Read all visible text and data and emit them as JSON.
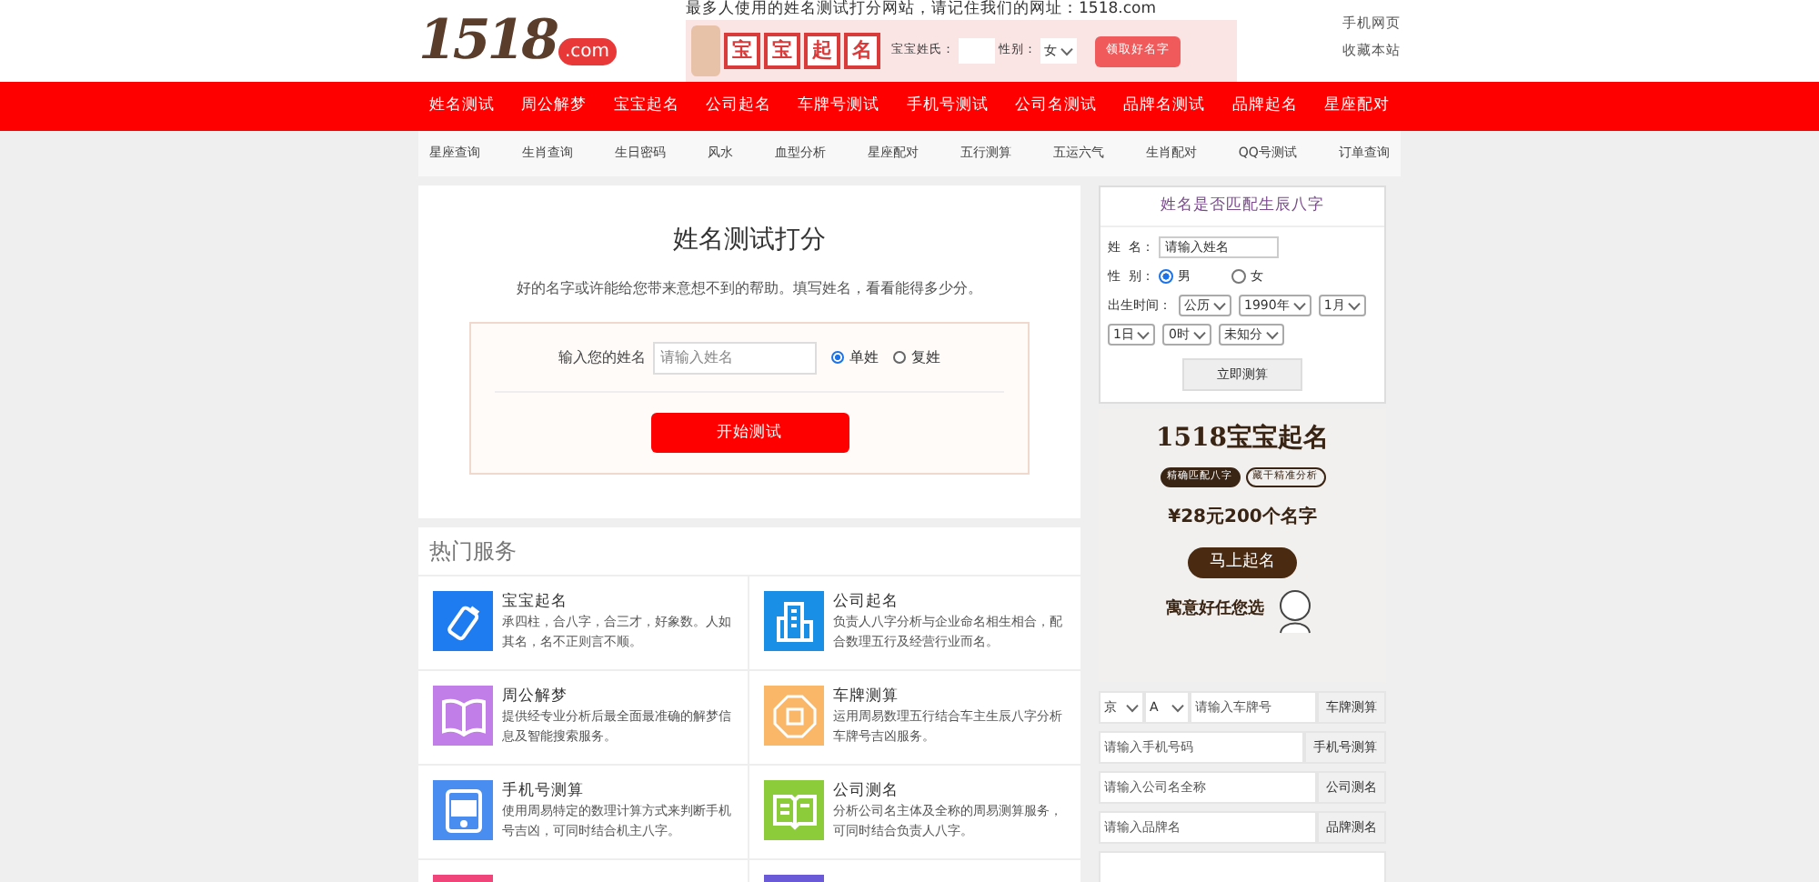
{
  "header": {
    "logo": "1518",
    "logo_badge": ".com",
    "tagline": "最多人使用的姓名测试打分网站，请记住我们的网址：1518.com",
    "promo": {
      "chars": [
        "宝",
        "宝",
        "起",
        "名"
      ],
      "surname_label": "宝宝姓氏：",
      "gender_label": "性别：",
      "gender_value": "女",
      "button": "领取好名字"
    },
    "links": [
      "手机网页",
      "收藏本站"
    ]
  },
  "nav": [
    "姓名测试",
    "周公解梦",
    "宝宝起名",
    "公司起名",
    "车牌号测试",
    "手机号测试",
    "公司名测试",
    "品牌名测试",
    "品牌起名",
    "星座配对"
  ],
  "subnav": [
    "星座查询",
    "生肖查询",
    "生日密码",
    "风水",
    "血型分析",
    "星座配对",
    "五行测算",
    "五运六气",
    "生肖配对",
    "QQ号测试",
    "订单查询"
  ],
  "test_card": {
    "title": "姓名测试打分",
    "subtitle": "好的名字或许能给您带来意想不到的帮助。填写姓名，看看能得多少分。",
    "input_label": "输入您的姓名",
    "placeholder": "请输入姓名",
    "options": [
      {
        "label": "单姓",
        "selected": true
      },
      {
        "label": "复姓",
        "selected": false
      }
    ],
    "button": "开始测试"
  },
  "services": {
    "title": "热门服务",
    "items": [
      {
        "kind": "bottle",
        "color": "#1e7cf0",
        "title": "宝宝起名",
        "desc": "承四柱，合八字，合三才，好象数。人如其名，名不正则言不顺。"
      },
      {
        "kind": "building",
        "color": "#1a8fe6",
        "title": "公司起名",
        "desc": "负责人八字分析与企业命名相生相合，配合数理五行及经营行业而名。"
      },
      {
        "kind": "book",
        "color": "#c17ee8",
        "title": "周公解梦",
        "desc": "提供经专业分析后最全面最准确的解梦信息及智能搜索服务。"
      },
      {
        "kind": "bagua",
        "color": "#fbb768",
        "title": "车牌测算",
        "desc": "运用周易数理五行结合车主生辰八字分析车牌号吉凶服务。"
      },
      {
        "kind": "phone",
        "color": "#4a8df0",
        "title": "手机号测算",
        "desc": "使用周易特定的数理计算方式来判断手机号吉凶，可同时结合机主八字。"
      },
      {
        "kind": "reader",
        "color": "#8ccc3a",
        "title": "公司测名",
        "desc": "分析公司名主体及全称的周易测算服务，可同时结合负责人八字。"
      },
      {
        "kind": "cut",
        "color": "#f0457a"
      },
      {
        "kind": "cut",
        "color": "#6a5ad8"
      }
    ]
  },
  "bazi": {
    "title": "姓名是否匹配生辰八字",
    "name_label": "姓  名：",
    "name_placeholder": "请输入姓名",
    "gender_label": "性  别：",
    "genders": [
      {
        "label": "男",
        "selected": true
      },
      {
        "label": "女",
        "selected": false
      }
    ],
    "birth_label": "出生时间：",
    "selects": [
      "公历",
      "1990年",
      "1月",
      "1日",
      "0时",
      "未知分"
    ],
    "button": "立即测算"
  },
  "ad": {
    "title": "1518宝宝起名",
    "tags": [
      "精确匹配八字",
      "藏干精准分析"
    ],
    "price": "¥28元200个名字",
    "button": "马上起名",
    "slogan": "寓意好任您选"
  },
  "tools": [
    {
      "kind": "plate",
      "selects": [
        "京",
        "A"
      ],
      "placeholder": "请输入车牌号",
      "button": "车牌测算"
    },
    {
      "kind": "input",
      "placeholder": "请输入手机号码",
      "button": "手机号测算"
    },
    {
      "kind": "input",
      "placeholder": "请输入公司名全称",
      "button": "公司测名"
    },
    {
      "kind": "input",
      "placeholder": "请输入品牌名",
      "button": "品牌测名"
    },
    {
      "kind": "cut"
    }
  ]
}
